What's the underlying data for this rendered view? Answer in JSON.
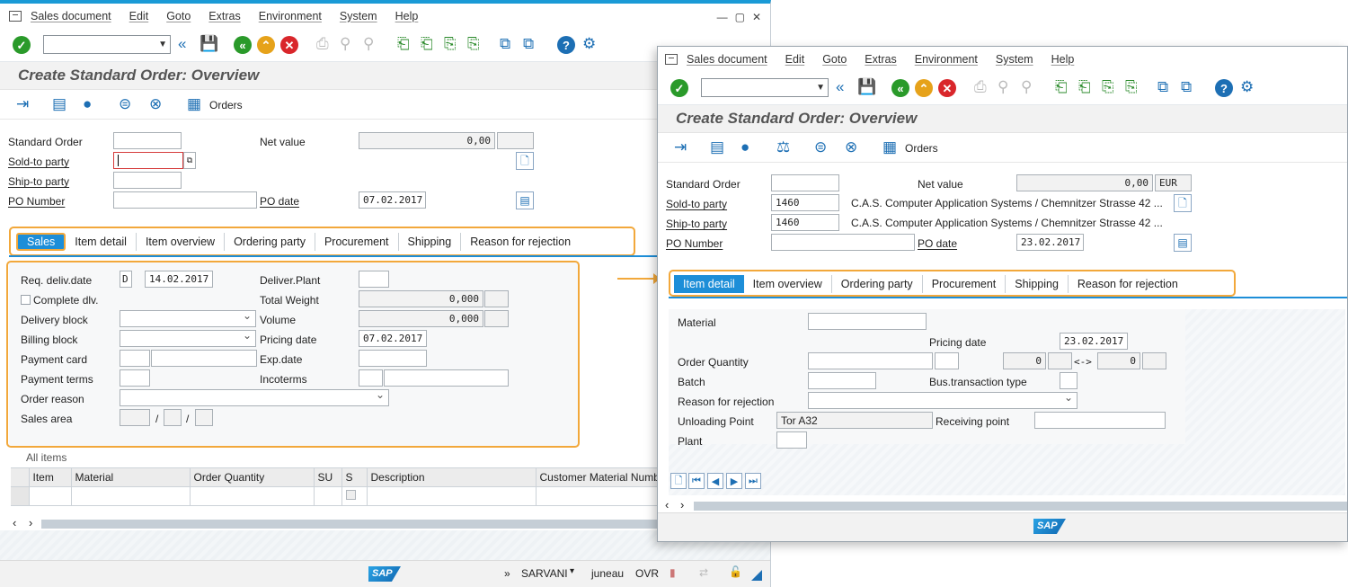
{
  "menu": [
    "Sales document",
    "Edit",
    "Goto",
    "Extras",
    "Environment",
    "System",
    "Help"
  ],
  "title": "Create Standard Order: Overview",
  "app_toolbar": {
    "orders_label": "Orders"
  },
  "w1": {
    "header": {
      "standard_order_label": "Standard Order",
      "sold_to_label": "Sold-to party",
      "ship_to_label": "Ship-to party",
      "po_number_label": "PO Number",
      "net_value_label": "Net value",
      "net_value": "0,00",
      "po_date_label": "PO date",
      "po_date": "07.02.2017"
    },
    "tabs": [
      "Sales",
      "Item detail",
      "Item overview",
      "Ordering party",
      "Procurement",
      "Shipping",
      "Reason for rejection"
    ],
    "sales": {
      "req_deliv_label": "Req. deliv.date",
      "req_deliv_type": "D",
      "req_deliv_date": "14.02.2017",
      "complete_dlv_label": "Complete dlv.",
      "delivery_block_label": "Delivery block",
      "billing_block_label": "Billing block",
      "payment_card_label": "Payment card",
      "payment_terms_label": "Payment terms",
      "order_reason_label": "Order reason",
      "sales_area_label": "Sales area",
      "sep": "/",
      "deliver_plant_label": "Deliver.Plant",
      "total_weight_label": "Total Weight",
      "total_weight": "0,000",
      "volume_label": "Volume",
      "volume": "0,000",
      "pricing_date_label": "Pricing date",
      "pricing_date": "07.02.2017",
      "exp_date_label": "Exp.date",
      "incoterms_label": "Incoterms"
    },
    "items": {
      "caption": "All items",
      "columns": [
        "Item",
        "Material",
        "Order Quantity",
        "SU",
        "S",
        "Description",
        "Customer Material Numb"
      ]
    },
    "status": {
      "system": "SARVANI",
      "server": "juneau",
      "mode": "OVR"
    }
  },
  "w2": {
    "header": {
      "standard_order_label": "Standard Order",
      "sold_to_label": "Sold-to party",
      "sold_to": "1460",
      "sold_to_desc": "C.A.S. Computer Application Systems / Chemnitzer Strasse 42 ...",
      "ship_to_label": "Ship-to party",
      "ship_to": "1460",
      "ship_to_desc": "C.A.S. Computer Application Systems / Chemnitzer Strasse 42 ...",
      "po_number_label": "PO Number",
      "net_value_label": "Net value",
      "net_value": "0,00",
      "currency": "EUR",
      "po_date_label": "PO date",
      "po_date": "23.02.2017"
    },
    "tabs": [
      "Item detail",
      "Item overview",
      "Ordering party",
      "Procurement",
      "Shipping",
      "Reason for rejection"
    ],
    "detail": {
      "material_label": "Material",
      "pricing_date_label": "Pricing date",
      "pricing_date": "23.02.2017",
      "order_qty_label": "Order Quantity",
      "qty_a": "0",
      "conv": "<->",
      "qty_b": "0",
      "batch_label": "Batch",
      "bus_type_label": "Bus.transaction type",
      "reason_label": "Reason for rejection",
      "unloading_label": "Unloading Point",
      "unloading": "Tor A32",
      "receiving_label": "Receiving point",
      "plant_label": "Plant"
    }
  },
  "colors": {
    "accent": "#1d8ed8",
    "highlight": "#f2a83b",
    "ok": "#2a9a2a",
    "cancel": "#d9262b"
  }
}
